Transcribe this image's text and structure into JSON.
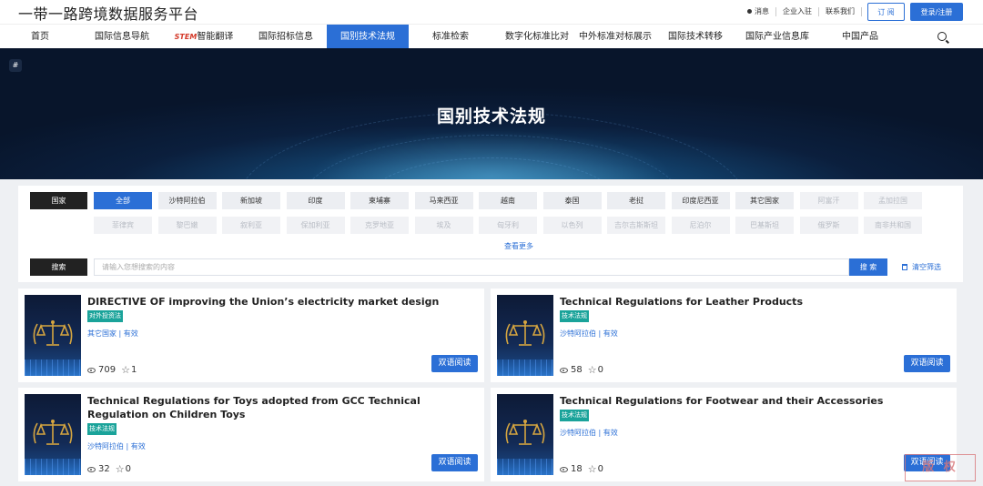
{
  "brand": "一带一路跨境数据服务平台",
  "top": {
    "messages": "消息",
    "enterprise": "企业入驻",
    "contact": "联系我们",
    "subscribe": "订 阅",
    "login": "登录/注册"
  },
  "nav": [
    {
      "label": "首页"
    },
    {
      "label": "国际信息导航"
    },
    {
      "label": "智能翻译",
      "prefix": "STEM"
    },
    {
      "label": "国际招标信息"
    },
    {
      "label": "国别技术法规",
      "active": true
    },
    {
      "label": "标准检索"
    },
    {
      "label": "数字化标准比对"
    },
    {
      "label": "中外标准对标展示"
    },
    {
      "label": "国际技术转移"
    },
    {
      "label": "国际产业信息库"
    },
    {
      "label": "中国产品"
    }
  ],
  "banner": {
    "title": "国别技术法规",
    "badge": "#"
  },
  "filter": {
    "country_label": "国家",
    "row1": [
      "全部",
      "沙特阿拉伯",
      "新加坡",
      "印度",
      "柬埔寨",
      "马来西亚",
      "越南",
      "泰国",
      "老挝",
      "印度尼西亚",
      "其它国家",
      "阿富汗",
      "孟加拉国"
    ],
    "row2": [
      "菲律宾",
      "黎巴嫩",
      "叙利亚",
      "保加利亚",
      "克罗地亚",
      "埃及",
      "匈牙利",
      "以色列",
      "吉尔吉斯斯坦",
      "尼泊尔",
      "巴基斯坦",
      "俄罗斯",
      "南非共和国"
    ],
    "more": "查看更多",
    "search_label": "搜索",
    "search_placeholder": "请输入您想搜索的内容",
    "search_button": "搜 索",
    "clear": "清空筛选"
  },
  "cards": [
    {
      "title": "DIRECTIVE OF improving the Union’s electricity market design",
      "tag": "对外投资法",
      "meta": "其它国家 | 有效",
      "views": "709",
      "stars": "1",
      "button": "双语阅读"
    },
    {
      "title": "Technical Regulations for Leather Products",
      "tag": "技术法规",
      "meta": "沙特阿拉伯 | 有效",
      "views": "58",
      "stars": "0",
      "button": "双语阅读"
    },
    {
      "title": "Technical Regulations for Toys adopted from GCC Technical Regulation on Children Toys",
      "tag": "技术法规",
      "meta": "沙特阿拉伯 | 有效",
      "views": "32",
      "stars": "0",
      "button": "双语阅读"
    },
    {
      "title": "Technical Regulations for Footwear and their Accessories",
      "tag": "技术法规",
      "meta": "沙特阿拉伯 | 有效",
      "views": "18",
      "stars": "0",
      "button": "双语阅读"
    }
  ],
  "watermark": "版 权"
}
